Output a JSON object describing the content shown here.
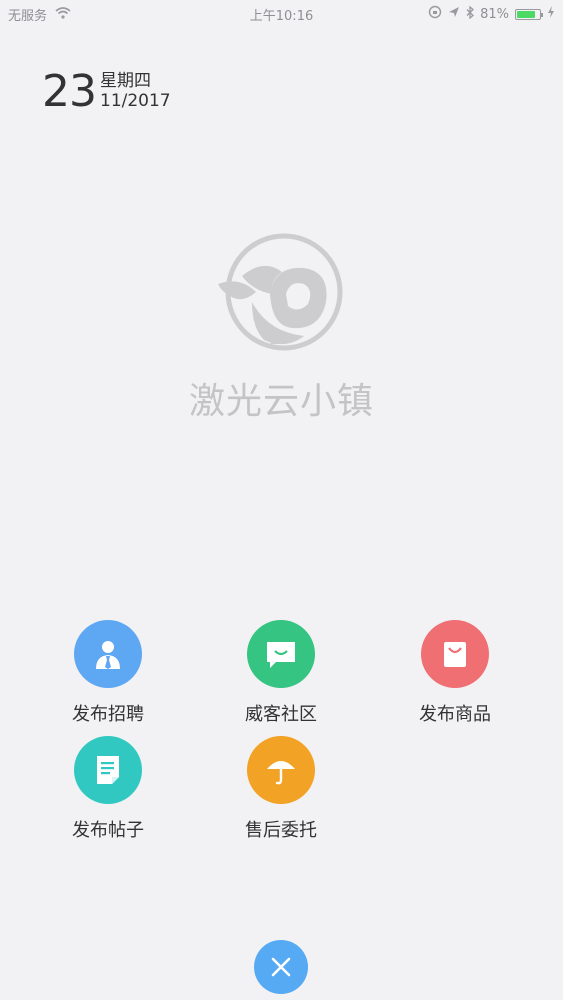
{
  "status_bar": {
    "carrier": "无服务",
    "time": "上午10:16",
    "battery": "81%",
    "battery_level": 0.81
  },
  "date": {
    "day": "23",
    "weekday": "星期四",
    "month_year": "11/2017"
  },
  "brand": {
    "name": "激光云小镇"
  },
  "actions": [
    {
      "label": "发布招聘",
      "icon": "person-suit-icon",
      "color": "#5ea7f2"
    },
    {
      "label": "威客社区",
      "icon": "chat-bubble-icon",
      "color": "#35c482"
    },
    {
      "label": "发布商品",
      "icon": "shopping-bag-icon",
      "color": "#ef6f73"
    },
    {
      "label": "发布帖子",
      "icon": "document-icon",
      "color": "#32c8c2"
    },
    {
      "label": "售后委托",
      "icon": "umbrella-icon",
      "color": "#f2a224"
    }
  ],
  "close": {
    "icon": "close-icon",
    "color": "#56aaf4"
  }
}
